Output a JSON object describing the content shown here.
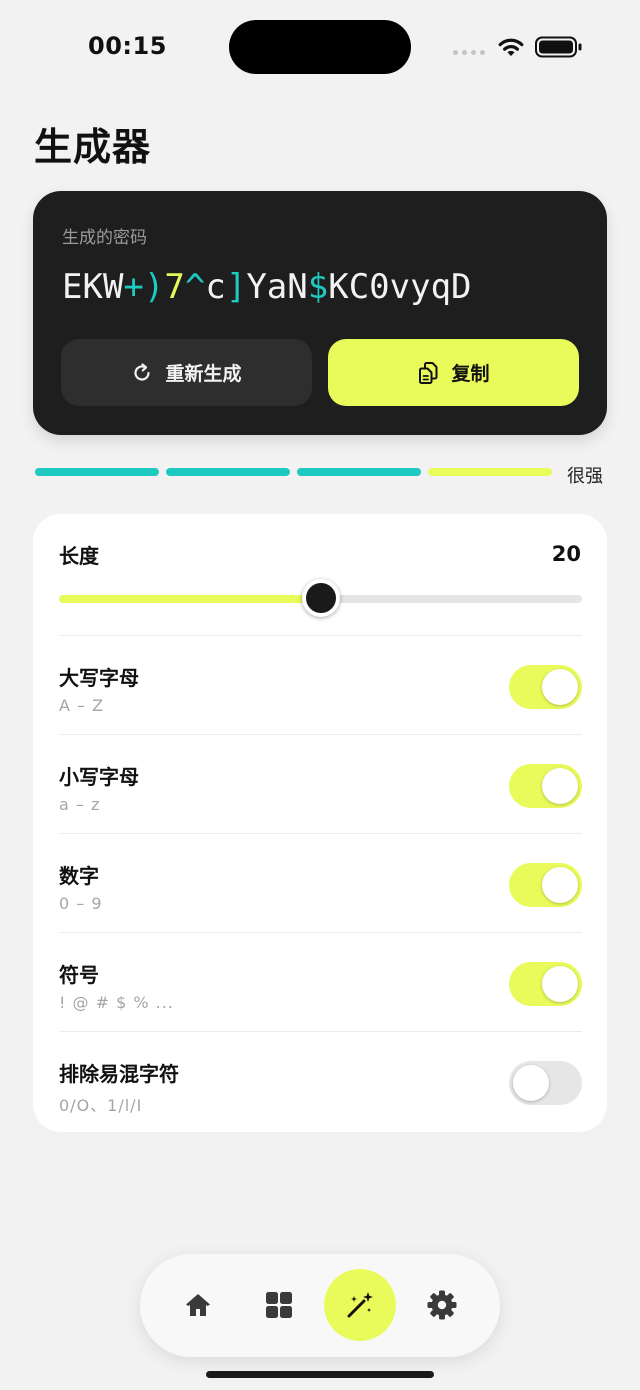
{
  "status_bar": {
    "time": "00:15"
  },
  "page": {
    "title": "生成器"
  },
  "password_card": {
    "caption": "生成的密码",
    "segments": [
      {
        "text": "EKW",
        "kind": "letter"
      },
      {
        "text": "+)",
        "kind": "symbol"
      },
      {
        "text": "7",
        "kind": "number"
      },
      {
        "text": "^",
        "kind": "symbol"
      },
      {
        "text": "c",
        "kind": "letter"
      },
      {
        "text": "]",
        "kind": "symbol"
      },
      {
        "text": "YaN",
        "kind": "letter"
      },
      {
        "text": "$",
        "kind": "symbol"
      },
      {
        "text": "KC0vyqD",
        "kind": "letter"
      }
    ],
    "regenerate_label": "重新生成",
    "copy_label": "复制"
  },
  "strength": {
    "label": "很强",
    "segments": [
      "#1ec9c1",
      "#1ec9c1",
      "#1ec9c1",
      "#e9fb5b"
    ]
  },
  "settings": {
    "length_label": "长度",
    "length_value": "20",
    "length_slider_fraction": 0.5,
    "options": [
      {
        "title": "大写字母",
        "subtitle": "A – Z",
        "enabled": true
      },
      {
        "title": "小写字母",
        "subtitle": "a – z",
        "enabled": true
      },
      {
        "title": "数字",
        "subtitle": "0 – 9",
        "enabled": true
      },
      {
        "title": "符号",
        "subtitle": "! @ # $ % ...",
        "enabled": true
      },
      {
        "title": "排除易混字符",
        "subtitle": "0/O、1/l/I",
        "enabled": false
      }
    ]
  },
  "tabbar": {
    "tabs": [
      {
        "icon": "home-icon",
        "active": false
      },
      {
        "icon": "grid-icon",
        "active": false
      },
      {
        "icon": "magic-wand-icon",
        "active": true
      },
      {
        "icon": "gear-icon",
        "active": false
      }
    ]
  },
  "colors": {
    "accent": "#e9fb5b",
    "teal": "#1ec9c1",
    "card_dark": "#1e1e1e",
    "background": "#f2f2f2"
  }
}
